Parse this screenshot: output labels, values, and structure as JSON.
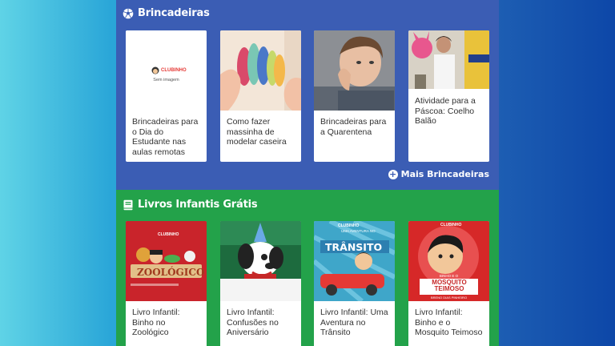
{
  "sections": {
    "games": {
      "title": "Brincadeiras",
      "more_label": "Mais Brincadeiras",
      "cards": [
        {
          "title": "Brincadeiras para o Dia do Estudante nas aulas remotas",
          "no_image_label": "Sem imagem",
          "logo_text": "CLUBINHO"
        },
        {
          "title": "Como fazer massinha de modelar caseira"
        },
        {
          "title": "Brincadeiras para a Quarentena"
        },
        {
          "title": "Atividade para a Páscoa: Coelho Balão"
        }
      ]
    },
    "books": {
      "title": "Livros Infantis Grátis",
      "cards": [
        {
          "title": "Livro Infantil: Binho no Zoológico",
          "cover_text": "ZOOLÓGICO",
          "cover_brand": "CLUBINHO"
        },
        {
          "title": "Livro Infantil: Confusões no Aniversário"
        },
        {
          "title": "Livro Infantil: Uma Aventura no Trânsito",
          "cover_text": "TRÂNSITO",
          "cover_subtitle": "UMA AVENTURA NO",
          "cover_brand": "CLUBINHO"
        },
        {
          "title": "Livro Infantil: Binho e o Mosquito Teimoso",
          "cover_text": "MOSQUITO TEIMOSO",
          "cover_subtitle": "BINHO E O",
          "cover_author": "BRENO DIAS PINHEIRO",
          "cover_brand": "CLUBINHO"
        }
      ]
    }
  },
  "colors": {
    "blue_section": "#3b5db4",
    "green_section": "#23a24a"
  }
}
